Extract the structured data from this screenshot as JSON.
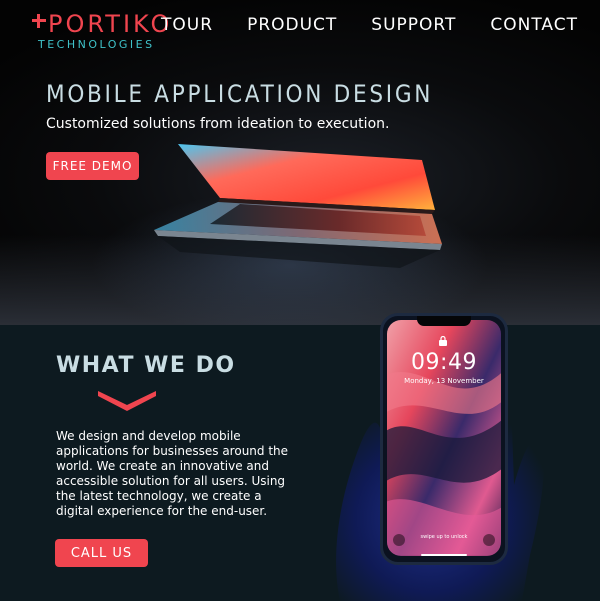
{
  "brand": {
    "name": "PORTIKO",
    "tagline": "TECHNOLOGIES",
    "primary_color": "#f0454f",
    "secondary_color": "#3fc2c9"
  },
  "nav": {
    "items": [
      {
        "label": "TOUR"
      },
      {
        "label": "PRODUCT"
      },
      {
        "label": "SUPPORT"
      },
      {
        "label": "CONTACT"
      }
    ]
  },
  "hero": {
    "title": "MOBILE APPLICATION DESIGN",
    "subtitle": "Customized solutions from ideation to execution.",
    "cta_label": "FREE DEMO",
    "image": "laptop-image"
  },
  "what_we_do": {
    "title": "WHAT WE DO",
    "body": "We design and develop mobile applications for businesses around the world. We create an innovative and accessible solution for all users. Using the latest technology, we create a digital experience for the end-user.",
    "cta_label": "CALL US",
    "image": "phone-in-hand-image"
  },
  "phone": {
    "time": "09:49",
    "date": "Monday, 13 November",
    "unlock_hint": "swipe up to unlock"
  }
}
